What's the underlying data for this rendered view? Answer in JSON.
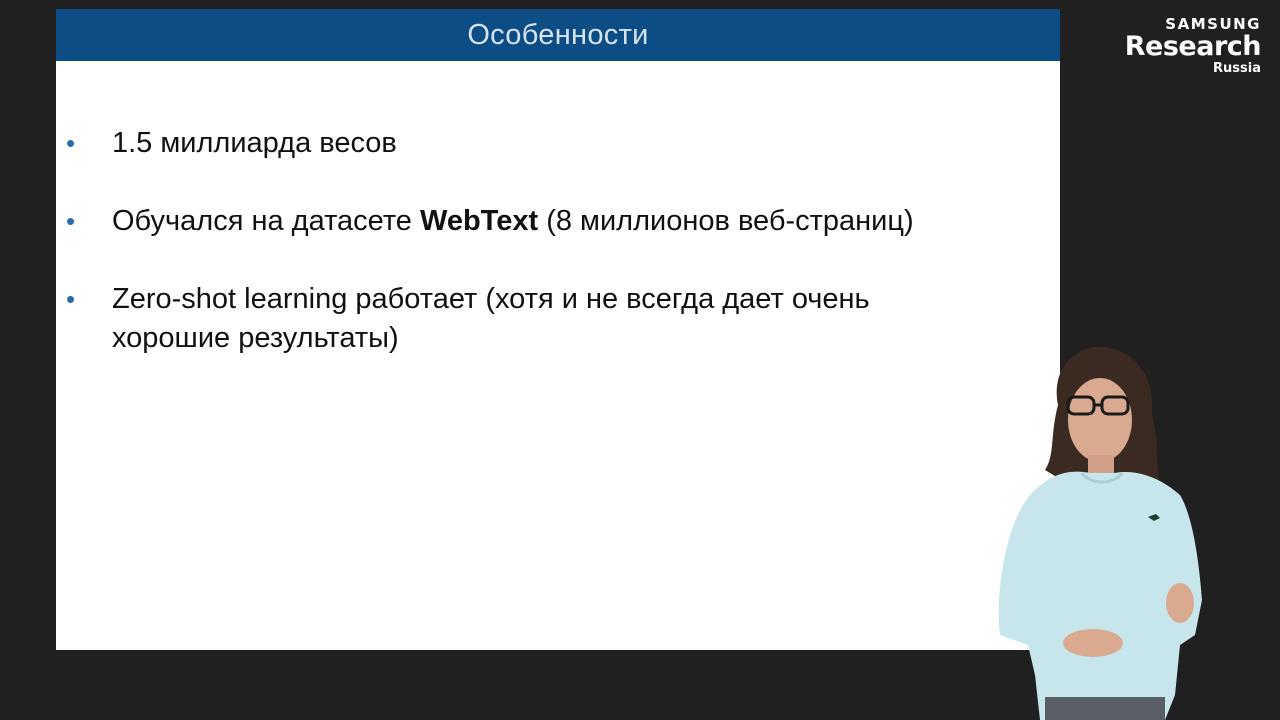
{
  "slide": {
    "title": "Особенности",
    "bullets": [
      {
        "text": "1.5 миллиарда весов"
      },
      {
        "before": "Обучался на датасете ",
        "bold": "WebText",
        "after": " (8 миллионов веб-страниц)"
      },
      {
        "text": "Zero-shot learning работает (хотя и не всегда дает очень\nхорошие результаты)"
      }
    ]
  },
  "logo": {
    "line1": "SAMSUNG",
    "line2": "Research",
    "line3": "Russia"
  },
  "colors": {
    "header_bg": "#0b4d84",
    "bullet": "#2a6aa8",
    "backdrop": "#202020"
  },
  "presenter": {
    "icon": "presenter-figure-icon"
  }
}
